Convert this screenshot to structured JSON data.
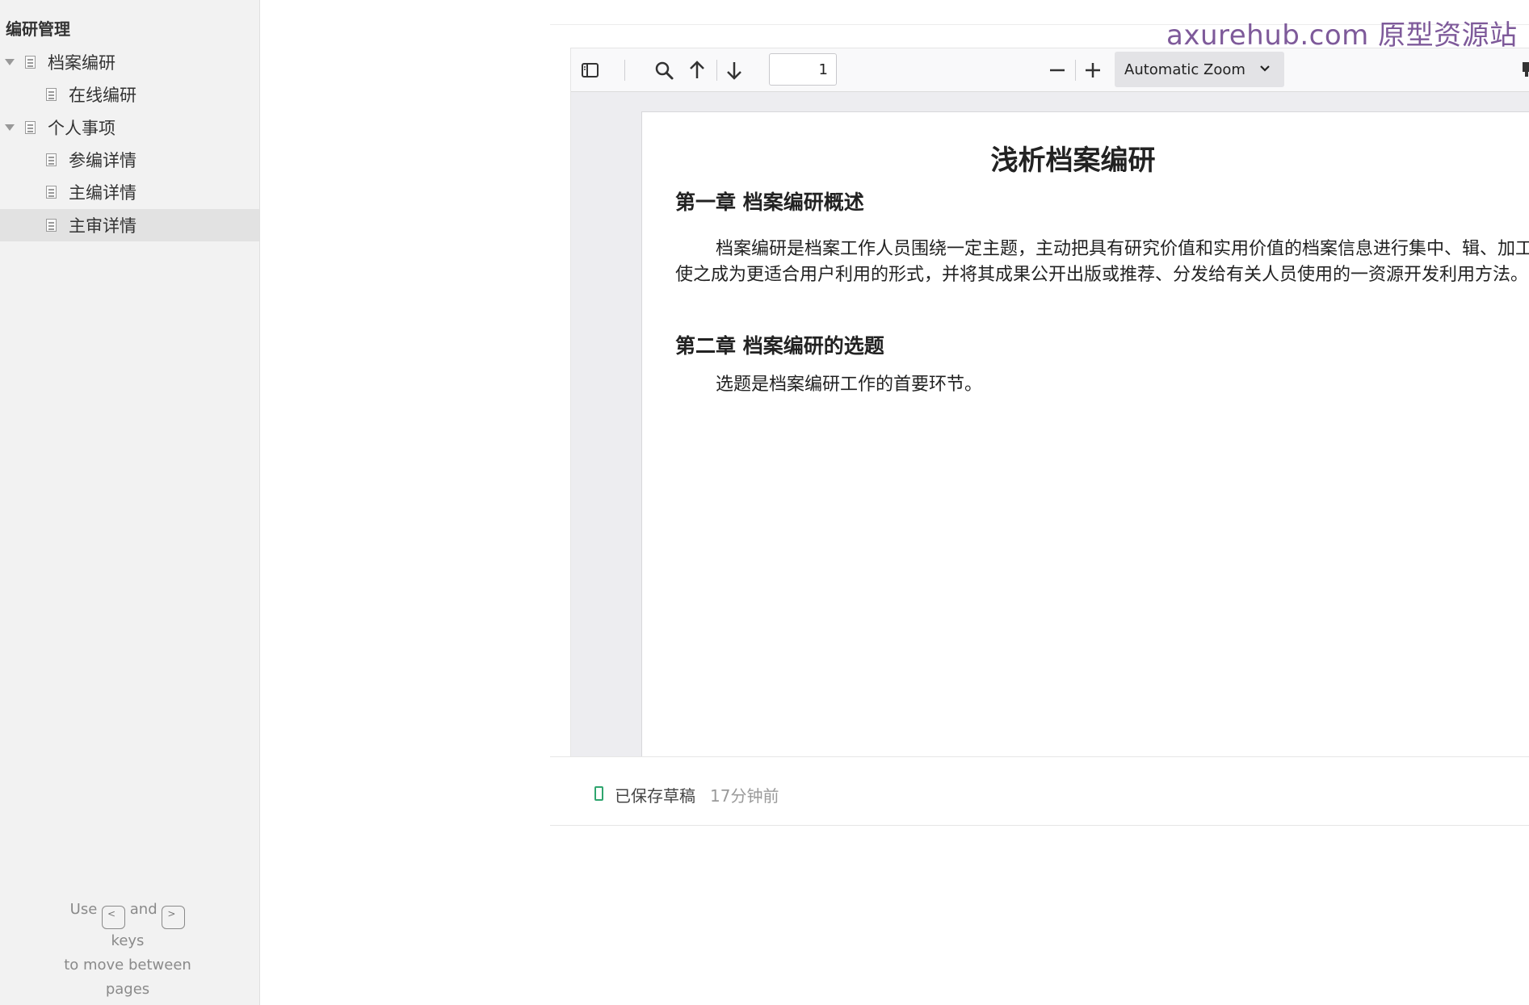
{
  "sidebar": {
    "title": "编研管理",
    "items": [
      {
        "label": "档案编研",
        "level": 0,
        "expanded": true
      },
      {
        "label": "在线编研",
        "level": 1
      },
      {
        "label": "个人事项",
        "level": 0,
        "expanded": true
      },
      {
        "label": "参编详情",
        "level": 1
      },
      {
        "label": "主编详情",
        "level": 1
      },
      {
        "label": "主审详情",
        "level": 1,
        "selected": true
      }
    ],
    "hint": {
      "use": "Use",
      "prev_key": "<",
      "and": "and",
      "next_key": ">",
      "keys": "keys",
      "line3": "to move between",
      "line4": "pages"
    }
  },
  "watermark": "axurehub.com 原型资源站",
  "viewer": {
    "toolbar": {
      "icons": [
        "sidebar-toggle-icon",
        "search-icon",
        "arrow-up-icon",
        "arrow-down-icon",
        "zoom-out-icon",
        "zoom-in-icon"
      ],
      "page_number": "1",
      "zoom_label": "Automatic Zoom"
    },
    "document": {
      "title": "浅析档案编研",
      "chapter1": "第一章  档案编研概述",
      "para1": "档案编研是档案工作人员围绕一定主题，主动把具有研究价值和实用价值的档案信息进行集中、辑、加工，使之成为更适合用户利用的形式，并将其成果公开出版或推荐、分发给有关人员使用的一资源开发利用方法。",
      "chapter2": "第二章  档案编研的选题",
      "para2": "选题是档案编研工作的首要环节。"
    }
  },
  "status": {
    "saved": "已保存草稿",
    "time": "17分钟前",
    "accent": "#2fa56e"
  }
}
